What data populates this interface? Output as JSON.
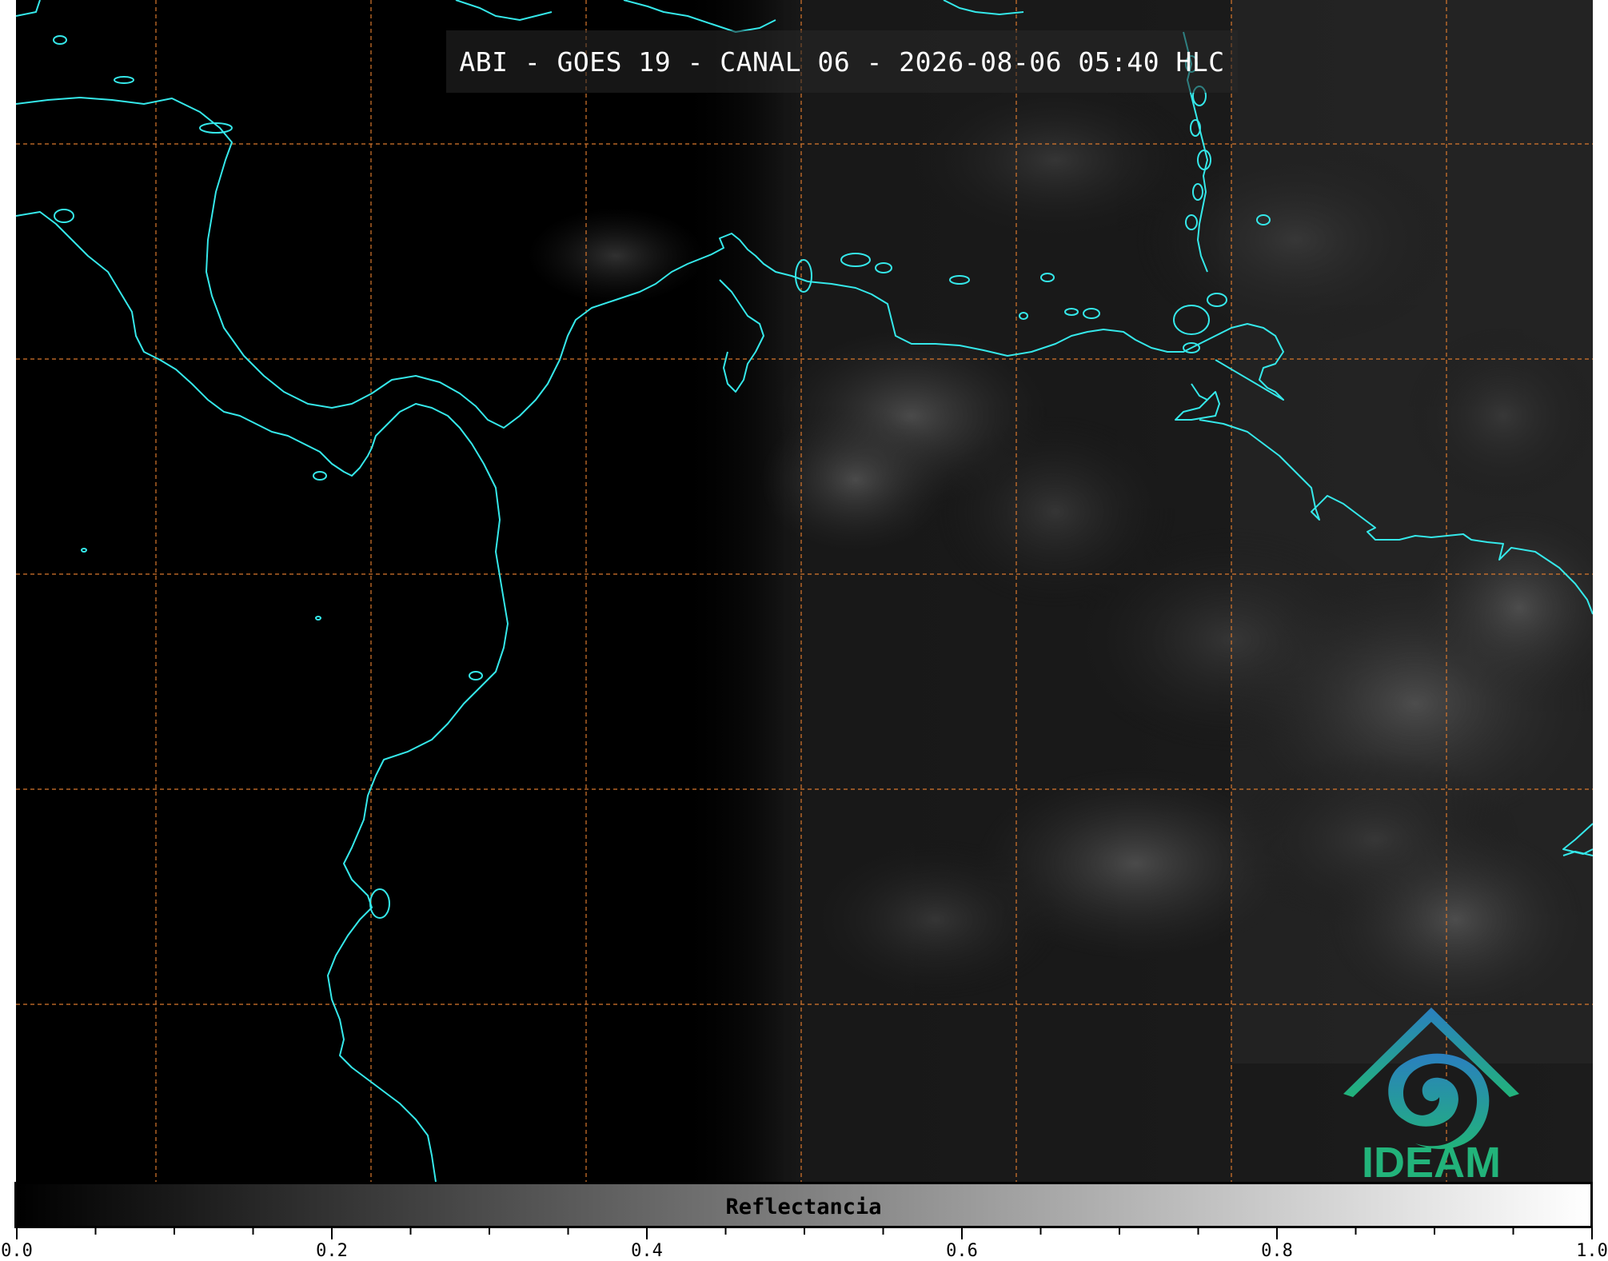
{
  "title": "ABI - GOES 19 - CANAL 06 - 2026-08-06 05:40 HLC",
  "colors": {
    "coastline": "#35e8ea",
    "gridline": "#d9782d",
    "logo_gradient_top": "#2a7fc0",
    "logo_gradient_bottom": "#22b37a"
  },
  "logo": {
    "name": "ideam-logo",
    "text": "IDEAM"
  },
  "colorbar": {
    "label": "Reflectancia",
    "min": 0.0,
    "max": 1.0,
    "colormap": "grayscale",
    "tick_labels": [
      "0.0",
      "0.2",
      "0.4",
      "0.6",
      "0.8",
      "1.0"
    ],
    "tick_values": [
      0.0,
      0.2,
      0.4,
      0.6,
      0.8,
      1.0
    ],
    "minor_tick_step": 0.05
  }
}
